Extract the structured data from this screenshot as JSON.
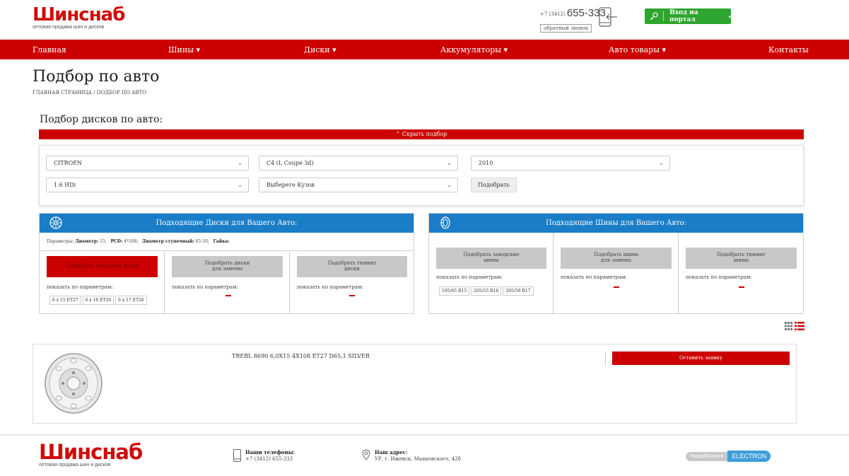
{
  "header": {
    "logo_name": "Шинснаб",
    "logo_tagline": "оптовая продажа шин и дисков",
    "phone_code": "+7 (3412)",
    "phone_number": "655-333",
    "callback": "обратный звонок",
    "login": "Вход на портал"
  },
  "nav": [
    "Главная",
    "Шины ▾",
    "Диски ▾",
    "Аккумуляторы ▾",
    "Авто товары ▾",
    "Контакты"
  ],
  "page": {
    "title": "Подбор по авто",
    "breadcrumb": "ГЛАВНАЯ СТРАНИЦА  / ПОДБОР ПО АВТО",
    "section_title": "Подбор дисков по авто:",
    "hide_bar": "⌃ Скрыть подбор"
  },
  "form": {
    "brand": "CITROEN",
    "model": "C4 (L Coupe 3d)",
    "year": "2010",
    "engine": "1.6 HDi",
    "body_placeholder": "Выберете Кузов",
    "submit": "Подобрать"
  },
  "disks_panel": {
    "title": "Подходящие Диски для Вашего Авто:",
    "params_label": "Параметры:",
    "diameter_label": "Диаметр:",
    "diameter_value": "15;",
    "pcd_label": "PCD:",
    "pcd_value": "4*108;",
    "hub_label": "Диаметр ступечный:",
    "hub_value": "65.10;",
    "nut_label": "Гайка:",
    "btn_factory": "Подобрать заводские диски",
    "btn_replace_line1": "Подобрать диски",
    "btn_replace_line2": "для замены",
    "btn_tuning_line1": "Подобрать тюнинг",
    "btn_tuning_line2": "диски",
    "show_by": "показать по параметрам:",
    "sizes": [
      "6 x 15 ET27",
      "6 x 16 ET26",
      "6 x 17 ET26"
    ]
  },
  "tires_panel": {
    "title": "Подходящие Шины для Вашего Авто:",
    "btn_factory_line1": "Подобрать заводские",
    "btn_factory_line2": "шины",
    "btn_replace_line1": "Подобрать шины",
    "btn_replace_line2": "для замены",
    "btn_tuning_line1": "Подобрать тюнинг",
    "btn_tuning_line2": "шины",
    "show_by": "показать по параметрам:",
    "sizes": [
      "195/65 R15",
      "205/55 R16",
      "205/50 R17"
    ]
  },
  "product": {
    "name": "TREBL 8690 6,0X15 4X108 ET27 D65,1 SILVER",
    "order": "Оставить заявку"
  },
  "footer": {
    "phones_title": "Наши телефоны:",
    "phones_value": "+7 (3412) 655-333",
    "address_title": "Наш адрес:",
    "address_value": "УР, г. Ижевск, Маяковского, 42б",
    "dev_label": "Разработано в",
    "dev_name": "ELECTRON"
  },
  "colors": {
    "brand_red": "#cc0000",
    "panel_blue": "#1a7dc7",
    "login_green": "#2ea52e"
  }
}
